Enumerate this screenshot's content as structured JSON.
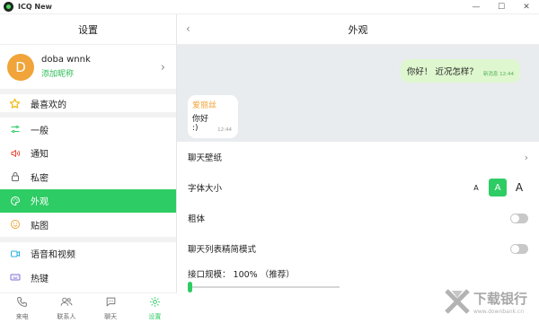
{
  "window": {
    "title": "ICQ New",
    "controls": [
      "—",
      "☐",
      "✕"
    ]
  },
  "sidebar": {
    "header": "设置",
    "profile": {
      "avatar_letter": "D",
      "name": "doba wnnk",
      "link": "添加昵称",
      "avatar_color": "#f0a43a"
    },
    "favorites": {
      "label": "最喜欢的"
    },
    "items": [
      {
        "key": "general",
        "label": "一般",
        "icon": "sliders-icon",
        "active": false
      },
      {
        "key": "notifications",
        "label": "通知",
        "icon": "speaker-icon",
        "active": false
      },
      {
        "key": "privacy",
        "label": "私密",
        "icon": "lock-icon",
        "active": false
      },
      {
        "key": "appearance",
        "label": "外观",
        "icon": "palette-icon",
        "active": true
      },
      {
        "key": "stickers",
        "label": "贴图",
        "icon": "smiley-icon",
        "active": false
      },
      {
        "key": "voice-video",
        "label": "语音和视频",
        "icon": "video-icon",
        "active": false
      },
      {
        "key": "hotkeys",
        "label": "热键",
        "icon": "keyboard-icon",
        "active": false
      }
    ],
    "accent_color": "#2ecc64"
  },
  "bottom_nav": [
    {
      "key": "calls",
      "label": "来电",
      "icon": "phone-icon",
      "active": false
    },
    {
      "key": "contacts",
      "label": "联系人",
      "icon": "contacts-icon",
      "active": false
    },
    {
      "key": "chats",
      "label": "聊天",
      "icon": "chat-icon",
      "active": false
    },
    {
      "key": "settings",
      "label": "设置",
      "icon": "gear-icon",
      "active": true
    }
  ],
  "main": {
    "title": "外观",
    "preview": {
      "outgoing": {
        "text": "你好！ 近况怎样？",
        "sender": "新消息",
        "time": "12:44"
      },
      "incoming": {
        "sender": "爱丽丝",
        "text": "你好 :)",
        "time": "12:44"
      }
    },
    "settings": {
      "wallpaper": {
        "label": "聊天壁纸"
      },
      "font_size": {
        "label": "字体大小",
        "options": [
          "A",
          "A",
          "A"
        ],
        "selected_index": 1
      },
      "bold": {
        "label": "粗体",
        "enabled": false
      },
      "compact_list": {
        "label": "聊天列表精简模式",
        "enabled": false
      },
      "interface_scale": {
        "label": "接口规模： 100% （推荐）",
        "value_percent": 100
      }
    }
  },
  "watermark": {
    "title": "下载银行",
    "url": "www.downbank.cn"
  }
}
